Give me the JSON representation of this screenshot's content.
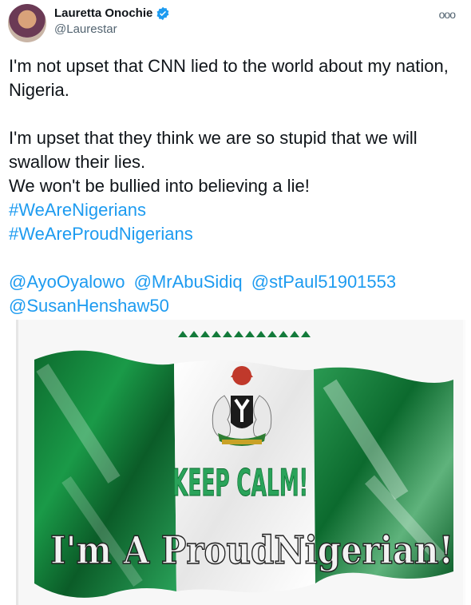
{
  "author": {
    "name": "Lauretta Onochie",
    "handle": "@Laurestar",
    "verified_icon": "verified-badge-icon",
    "avatar_icon": "avatar-image"
  },
  "menu": {
    "more_label": "ooo"
  },
  "tweet": {
    "line1": "I'm not upset that CNN lied to the world about my nation, Nigeria.",
    "line2": "I'm upset that they think we are so stupid that we will swallow their lies.",
    "line3": "We won't be bullied into believing a lie!",
    "hashtags": [
      "#WeAreNigerians",
      "#WeAreProudNigerians"
    ],
    "mentions": [
      "@AyoOyalowo",
      "@MrAbuSidiq",
      "@stPaul51901553",
      "@SusanHenshaw50"
    ]
  },
  "image": {
    "text_keep_calm": "KEEP CALM!",
    "text_proud": "I'm A ProudNigerian!",
    "colors": {
      "green": "#0b8a3a",
      "white": "#ffffff",
      "text_green": "#1f9a4a"
    }
  }
}
